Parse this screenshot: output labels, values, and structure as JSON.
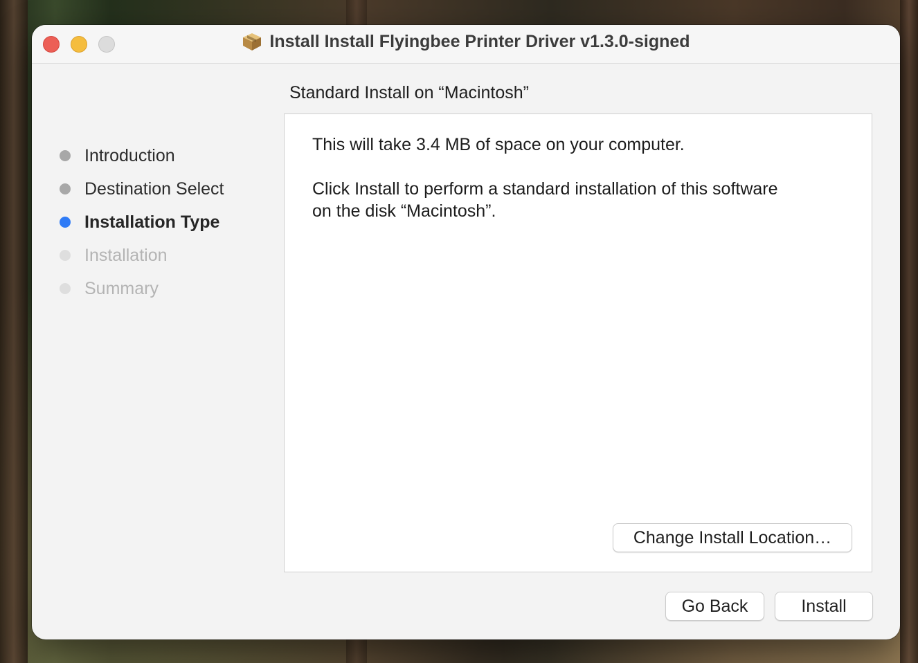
{
  "window": {
    "title": "Install Install Flyingbee Printer Driver v1.3.0-signed",
    "app_icon": "package-icon"
  },
  "sidebar": {
    "steps": [
      {
        "label": "Introduction",
        "state": "completed"
      },
      {
        "label": "Destination Select",
        "state": "completed"
      },
      {
        "label": "Installation Type",
        "state": "current"
      },
      {
        "label": "Installation",
        "state": "pending"
      },
      {
        "label": "Summary",
        "state": "pending"
      }
    ]
  },
  "main": {
    "heading": "Standard Install on “Macintosh”",
    "space_text": "This will take 3.4 MB of space on your computer.",
    "install_text_line1": "Click Install to perform a standard installation of this software",
    "install_text_line2": "on the disk “Macintosh”.",
    "change_location_label": "Change Install Location…"
  },
  "footer": {
    "go_back_label": "Go Back",
    "install_label": "Install"
  },
  "colors": {
    "current_step": "#2f7bf6",
    "completed_step": "#a8a8a8",
    "pending_step": "#dedede",
    "close": "#ec5f56",
    "minimize": "#f5bd3e",
    "zoom_disabled": "#dcdcdc"
  }
}
